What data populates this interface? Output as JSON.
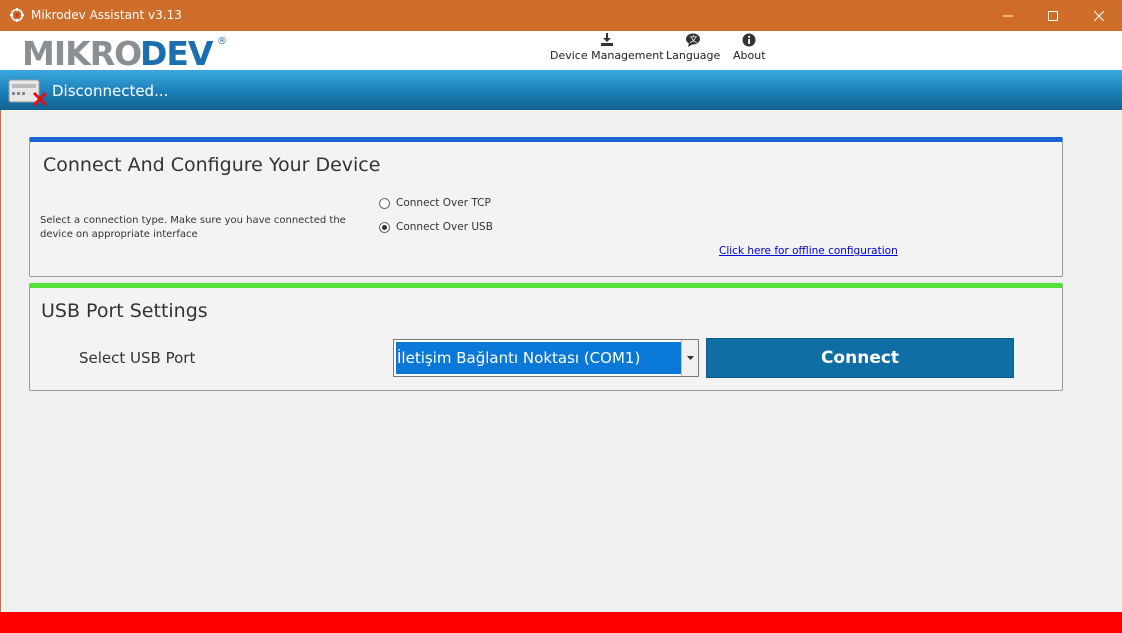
{
  "window": {
    "title": "Mikrodev Assistant v3.13"
  },
  "header": {
    "logo_text": "MIKRODEV",
    "menu": [
      {
        "label": "Device Management",
        "icon": "download-icon"
      },
      {
        "label": "Language",
        "icon": "language-icon"
      },
      {
        "label": "About",
        "icon": "info-icon"
      }
    ]
  },
  "status": {
    "text": "Disconnected...",
    "icon": "device-disconnected-icon"
  },
  "connect_panel": {
    "title": "Connect And Configure Your Device",
    "hint": "Select a connection type. Make sure you have connected the device on appropriate interface",
    "options": [
      {
        "label": "Connect Over TCP",
        "selected": false
      },
      {
        "label": "Connect Over USB",
        "selected": true
      }
    ],
    "offline_link": "Click here for offline configuration"
  },
  "usb_panel": {
    "title": "USB Port Settings",
    "port_label": "Select USB Port",
    "selected_port": "İletişim Bağlantı Noktası (COM1)",
    "connect_label": "Connect"
  },
  "colors": {
    "titlebar": "#cf6d2a",
    "panel1_accent": "#1a63d6",
    "panel2_accent": "#55e03a",
    "connect_button": "#0f6fa5",
    "bottom_bar": "#ff0000"
  }
}
